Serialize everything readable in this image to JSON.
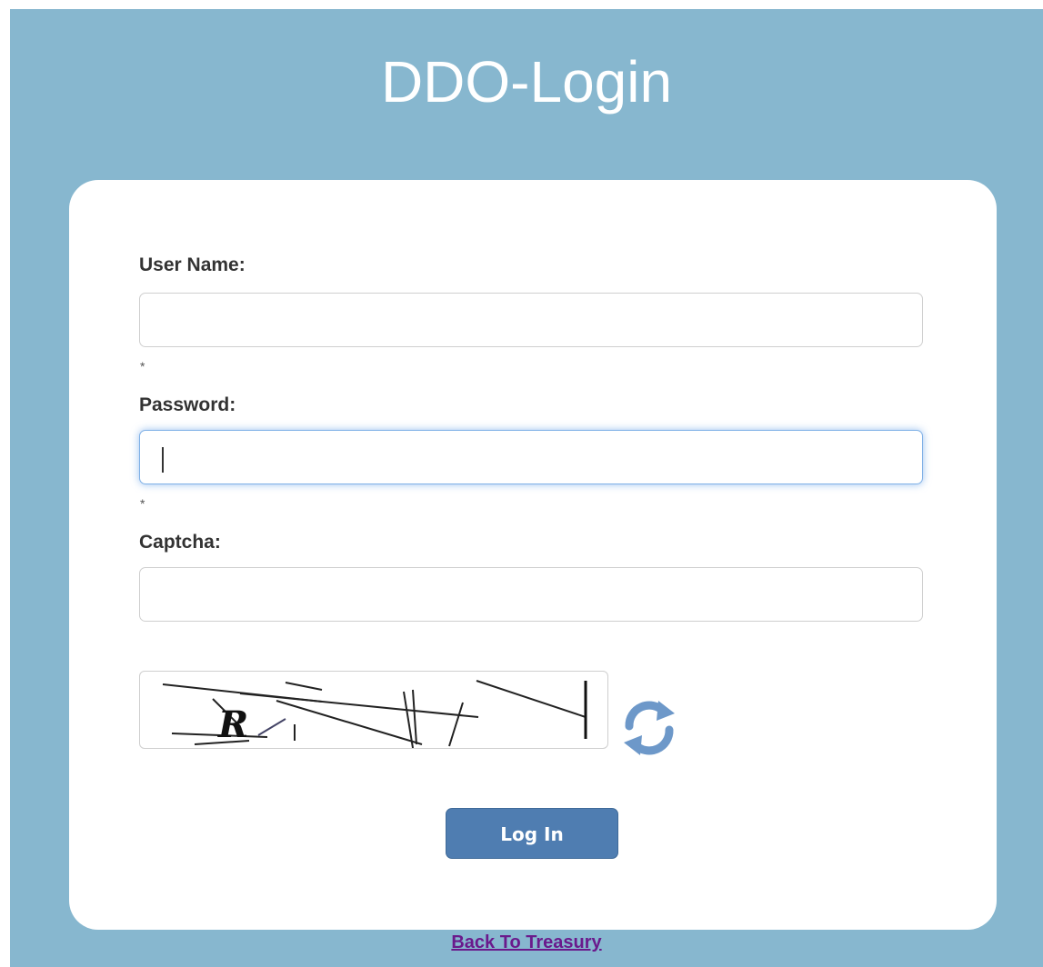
{
  "page": {
    "title": "DDO-Login",
    "background_color": "#87b7cf"
  },
  "form": {
    "username": {
      "label": "User Name:",
      "value": "",
      "required_marker": "*"
    },
    "password": {
      "label": "Password:",
      "value": "",
      "required_marker": "*",
      "focused": true
    },
    "captcha": {
      "label": "Captcha:",
      "value": "",
      "image_icon": "captcha-image",
      "refresh_icon": "refresh-icon"
    },
    "submit_label": "Log In",
    "submit_color": "#4f7db1"
  },
  "footer": {
    "back_link": "Back To Treasury",
    "link_color": "#6a1a8c"
  }
}
